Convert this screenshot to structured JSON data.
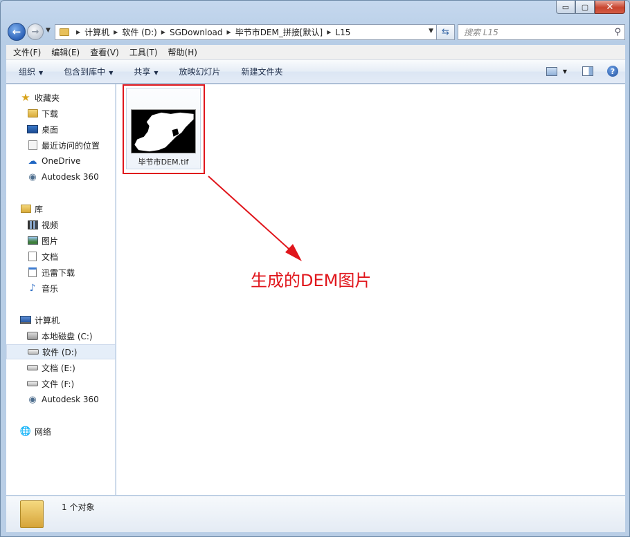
{
  "window": {
    "caption_buttons": {
      "minimize": "▭",
      "maximize": "▢",
      "close": "✕"
    }
  },
  "nav": {
    "back_icon": "back-arrow-icon",
    "forward_icon": "forward-arrow-icon",
    "breadcrumbs": [
      "计算机",
      "软件 (D:)",
      "SGDownload",
      "毕节市DEM_拼接[默认]",
      "L15"
    ],
    "search_placeholder": "搜索 L15"
  },
  "menu": [
    "文件(F)",
    "编辑(E)",
    "查看(V)",
    "工具(T)",
    "帮助(H)"
  ],
  "commands": [
    {
      "label": "组织",
      "has_arrow": true
    },
    {
      "label": "包含到库中",
      "has_arrow": true
    },
    {
      "label": "共享",
      "has_arrow": true
    },
    {
      "label": "放映幻灯片",
      "has_arrow": false
    },
    {
      "label": "新建文件夹",
      "has_arrow": false
    }
  ],
  "sidebar": {
    "favorites": {
      "label": "收藏夹",
      "items": [
        "下载",
        "桌面",
        "最近访问的位置",
        "OneDrive",
        "Autodesk 360"
      ]
    },
    "libraries": {
      "label": "库",
      "items": [
        "视频",
        "图片",
        "文档",
        "迅雷下载",
        "音乐"
      ]
    },
    "computer": {
      "label": "计算机",
      "items": [
        "本地磁盘 (C:)",
        "软件 (D:)",
        "文档 (E:)",
        "文件 (F:)",
        "Autodesk 360"
      ],
      "selected_index": 1
    },
    "network": {
      "label": "网络"
    }
  },
  "content": {
    "file": {
      "name": "毕节市DEM.tif"
    },
    "annotation": "生成的DEM图片",
    "accent_color": "#e0161c"
  },
  "status": {
    "text": "1 个对象"
  }
}
